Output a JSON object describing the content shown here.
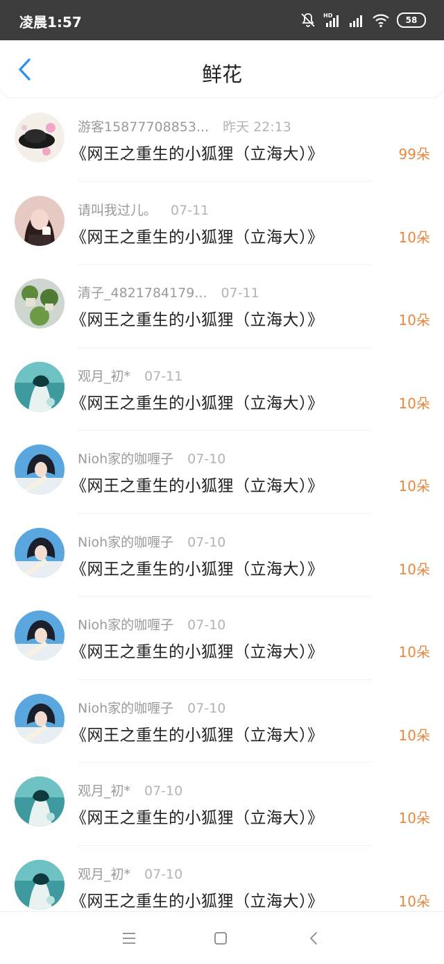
{
  "status_bar": {
    "time": "凌晨1:57",
    "battery": "58",
    "icons": [
      "mute-icon",
      "hd-signal-icon",
      "signal-icon",
      "wifi-icon",
      "battery-icon"
    ]
  },
  "header": {
    "title": "鲜花",
    "back_icon": "chevron-left-icon"
  },
  "colors": {
    "accent": "#2a8ff0",
    "flower_count": "#e8873d",
    "status_bar_bg": "#3c3c3c"
  },
  "list": {
    "items": [
      {
        "user": "游客15877708853...",
        "time": "昨天 22:13",
        "book": "《网王之重生的小狐狸（立海大）》",
        "count": "99朵",
        "avatar": "avatar-black-hat"
      },
      {
        "user": "请叫我过儿。",
        "time": "07-11",
        "book": "《网王之重生的小狐狸（立海大）》",
        "count": "10朵",
        "avatar": "avatar-girl"
      },
      {
        "user": "清子_4821784179...",
        "time": "07-11",
        "book": "《网王之重生的小狐狸（立海大）》",
        "count": "10朵",
        "avatar": "avatar-plants"
      },
      {
        "user": "观月_初*",
        "time": "07-11",
        "book": "《网王之重生的小狐狸（立海大）》",
        "count": "10朵",
        "avatar": "avatar-anime-teal"
      },
      {
        "user": "Nioh家的咖喱子",
        "time": "07-10",
        "book": "《网王之重生的小狐狸（立海大）》",
        "count": "10朵",
        "avatar": "avatar-anime-blue"
      },
      {
        "user": "Nioh家的咖喱子",
        "time": "07-10",
        "book": "《网王之重生的小狐狸（立海大）》",
        "count": "10朵",
        "avatar": "avatar-anime-blue"
      },
      {
        "user": "Nioh家的咖喱子",
        "time": "07-10",
        "book": "《网王之重生的小狐狸（立海大）》",
        "count": "10朵",
        "avatar": "avatar-anime-blue"
      },
      {
        "user": "Nioh家的咖喱子",
        "time": "07-10",
        "book": "《网王之重生的小狐狸（立海大）》",
        "count": "10朵",
        "avatar": "avatar-anime-blue"
      },
      {
        "user": "观月_初*",
        "time": "07-10",
        "book": "《网王之重生的小狐狸（立海大）》",
        "count": "10朵",
        "avatar": "avatar-anime-teal"
      },
      {
        "user": "观月_初*",
        "time": "07-10",
        "book": "《网王之重生的小狐狸（立海大）》",
        "count": "10朵",
        "avatar": "avatar-anime-teal"
      }
    ]
  },
  "nav_bar": {
    "icons": [
      "menu-icon",
      "home-square-icon",
      "back-triangle-icon"
    ]
  }
}
